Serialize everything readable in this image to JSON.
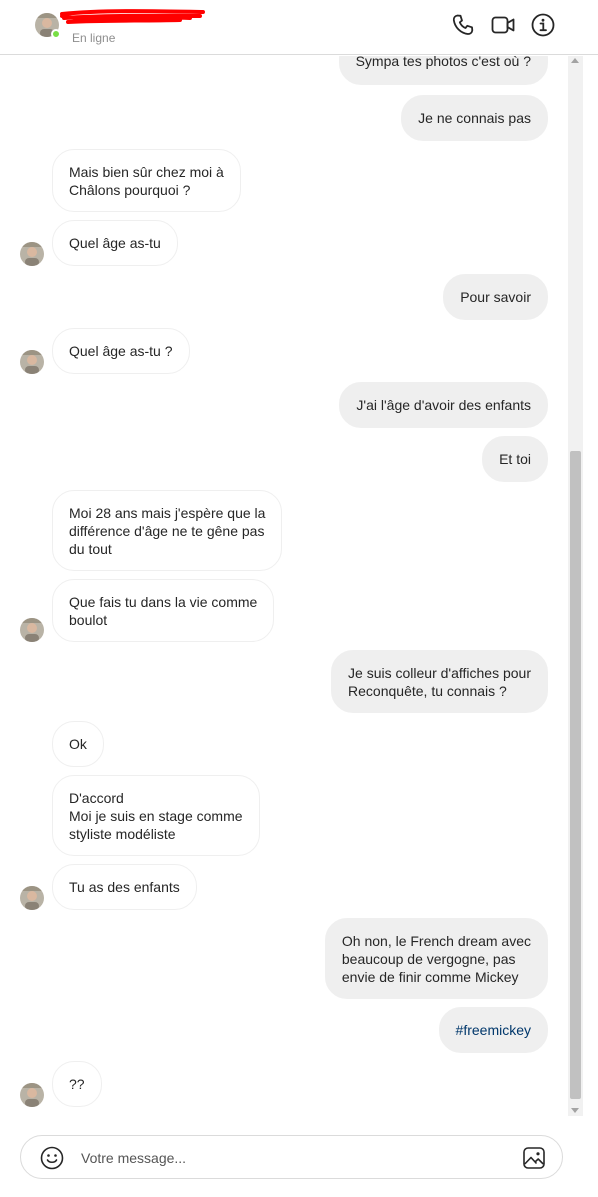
{
  "header": {
    "status": "En ligne",
    "icons": [
      "phone-icon",
      "video-camera-icon",
      "info-icon"
    ]
  },
  "messages": [
    {
      "dir": "out",
      "text": "Sympa tes photos c'est où ?"
    },
    {
      "dir": "out",
      "text": "Je ne connais pas"
    },
    {
      "dir": "in",
      "text": "Mais bien sûr chez moi à\nChâlons pourquoi ?"
    },
    {
      "dir": "in",
      "text": "Quel âge as-tu"
    },
    {
      "dir": "out",
      "text": "Pour savoir"
    },
    {
      "dir": "in",
      "text": "Quel âge as-tu ?"
    },
    {
      "dir": "out",
      "text": "J'ai l'âge d'avoir des enfants"
    },
    {
      "dir": "out",
      "text": "Et toi"
    },
    {
      "dir": "in",
      "text": "Moi 28 ans mais j'espère que la\ndifférence d'âge ne te gêne pas\ndu tout"
    },
    {
      "dir": "in",
      "text": "Que fais tu dans la vie comme\nboulot"
    },
    {
      "dir": "out",
      "text": "Je suis colleur d'affiches pour\nReconquête, tu connais ?"
    },
    {
      "dir": "in",
      "text": "Ok"
    },
    {
      "dir": "in",
      "text": "D'accord\nMoi je suis en stage comme\nstyliste modéliste"
    },
    {
      "dir": "in",
      "text": "Tu as des enfants"
    },
    {
      "dir": "out",
      "text": "Oh non, le French dream avec\nbeaucoup de vergogne, pas\nenvie de finir comme Mickey"
    },
    {
      "dir": "out",
      "text": "#freemickey"
    },
    {
      "dir": "in",
      "text": "??"
    }
  ],
  "composer": {
    "placeholder": "Votre message...",
    "icons": [
      "emoji-icon",
      "image-icon"
    ]
  },
  "colors": {
    "online": "#78de45",
    "bubble_out": "#efefef",
    "bubble_in_border": "#efefef",
    "hashtag": "#00376b",
    "redaction": "#ff0000"
  }
}
